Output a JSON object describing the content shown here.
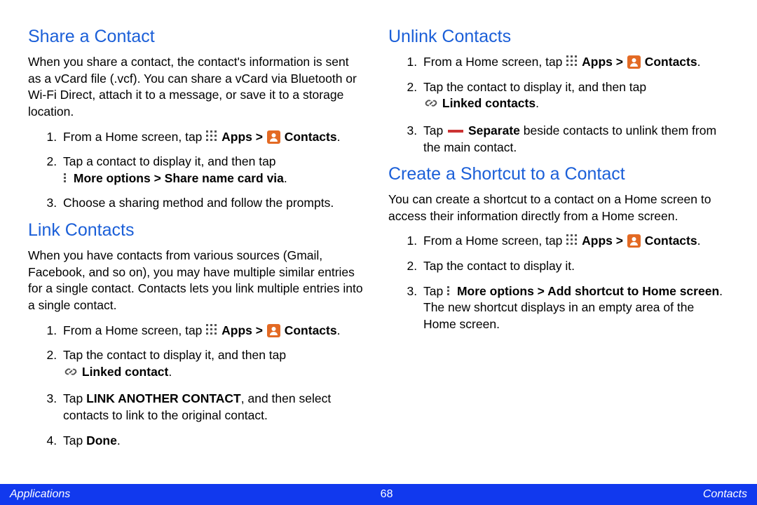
{
  "left": {
    "s1": {
      "h": "Share a Contact",
      "p": "When you share a contact, the contact's information is sent as a vCard file (.vcf). You can share a vCard via Bluetooth or Wi-Fi Direct, attach it to a message, or save it to a storage location.",
      "li1a": "From a Home screen, tap ",
      "li1apps": "Apps > ",
      "li1cont": "Contacts",
      "li2a": "Tap a contact to display it, and then tap ",
      "li2b": "More options > Share name card via",
      "li3": "Choose a sharing method and follow the prompts."
    },
    "s2": {
      "h": "Link Contacts",
      "p": "When you have contacts from various sources (Gmail, Facebook, and so on), you may have multiple similar entries for a single contact. Contacts lets you link multiple entries into a single contact.",
      "li1a": "From a Home screen, tap ",
      "li1apps": "Apps > ",
      "li1cont": "Contacts",
      "li2a": "Tap the contact to display it, and then tap ",
      "li2b": "Linked contact",
      "li3a": "Tap ",
      "li3b": "LINK ANOTHER CONTACT",
      "li3c": ", and then select contacts to link to the original contact.",
      "li4a": "Tap ",
      "li4b": "Done"
    }
  },
  "right": {
    "s1": {
      "h": "Unlink Contacts",
      "li1a": "From a Home screen, tap ",
      "li1apps": "Apps > ",
      "li1cont": "Contacts",
      "li2a": "Tap the contact to display it, and then tap ",
      "li2b": "Linked contacts",
      "li3a": "Tap ",
      "li3b": "Separate",
      "li3c": " beside contacts to unlink them from the main contact."
    },
    "s2": {
      "h": "Create a Shortcut to a Contact",
      "p": "You can create a shortcut to a contact on a Home screen to access their information directly from a Home screen.",
      "li1a": "From a Home screen, tap ",
      "li1apps": "Apps > ",
      "li1cont": "Contacts",
      "li2": "Tap the contact to display it.",
      "li3a": "Tap ",
      "li3b": "More options > Add shortcut to Home screen",
      "li3c": ". The new shortcut displays in an empty area of the Home screen."
    }
  },
  "footer": {
    "left": "Applications",
    "center": "68",
    "right": "Contacts"
  }
}
